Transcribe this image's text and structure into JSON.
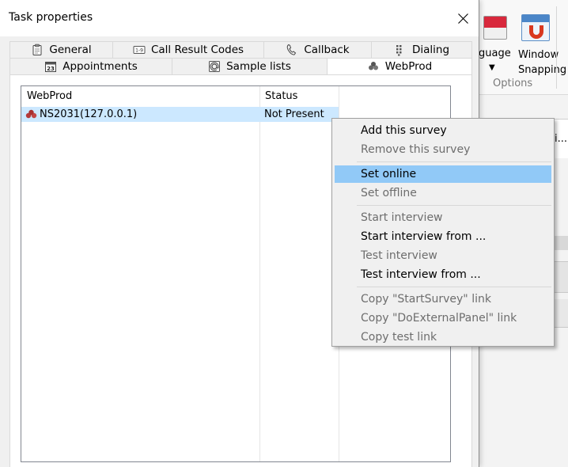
{
  "background_app": {
    "ribbon": {
      "language_label": "guage",
      "window_snapping_label_1": "Window",
      "window_snapping_label_2": "Snapping",
      "group_label": "Options",
      "arrow": "▼"
    },
    "truncated_text": "i..."
  },
  "dialog": {
    "title": "Task properties",
    "tabs_row1": [
      {
        "label": "General",
        "icon": "clipboard-icon"
      },
      {
        "label": "Call Result Codes",
        "icon": "codes-icon"
      },
      {
        "label": "Callback",
        "icon": "phone-icon"
      },
      {
        "label": "Dialing",
        "icon": "dialpad-icon"
      }
    ],
    "tabs_row2": [
      {
        "label": "Appointments",
        "icon": "calendar-icon",
        "calendar_day": "23"
      },
      {
        "label": "Sample lists",
        "icon": "email-icon"
      },
      {
        "label": "WebProd",
        "icon": "webprod-icon",
        "active": true
      }
    ],
    "list": {
      "columns": [
        "WebProd",
        "Status"
      ],
      "rows": [
        {
          "name": "NS2031(127.0.0.1)",
          "status": "Not Present",
          "selected": true
        }
      ]
    }
  },
  "context_menu": {
    "items": [
      {
        "label": "Add this survey",
        "enabled": true
      },
      {
        "label": "Remove this survey",
        "enabled": false
      },
      {
        "label": "Set online",
        "enabled": true,
        "highlighted": true
      },
      {
        "label": "Set offline",
        "enabled": false
      },
      {
        "label": "Start interview",
        "enabled": false
      },
      {
        "label": "Start interview from ...",
        "enabled": true
      },
      {
        "label": "Test interview",
        "enabled": false
      },
      {
        "label": "Test interview from ...",
        "enabled": true
      },
      {
        "label": "Copy \"StartSurvey\" link",
        "enabled": false
      },
      {
        "label": "Copy \"DoExternalPanel\" link",
        "enabled": false
      },
      {
        "label": "Copy test link",
        "enabled": false
      }
    ]
  },
  "colors": {
    "selection": "#cce8ff",
    "menu_highlight": "#91c9f7",
    "disabled_text": "#6d6d6d"
  }
}
